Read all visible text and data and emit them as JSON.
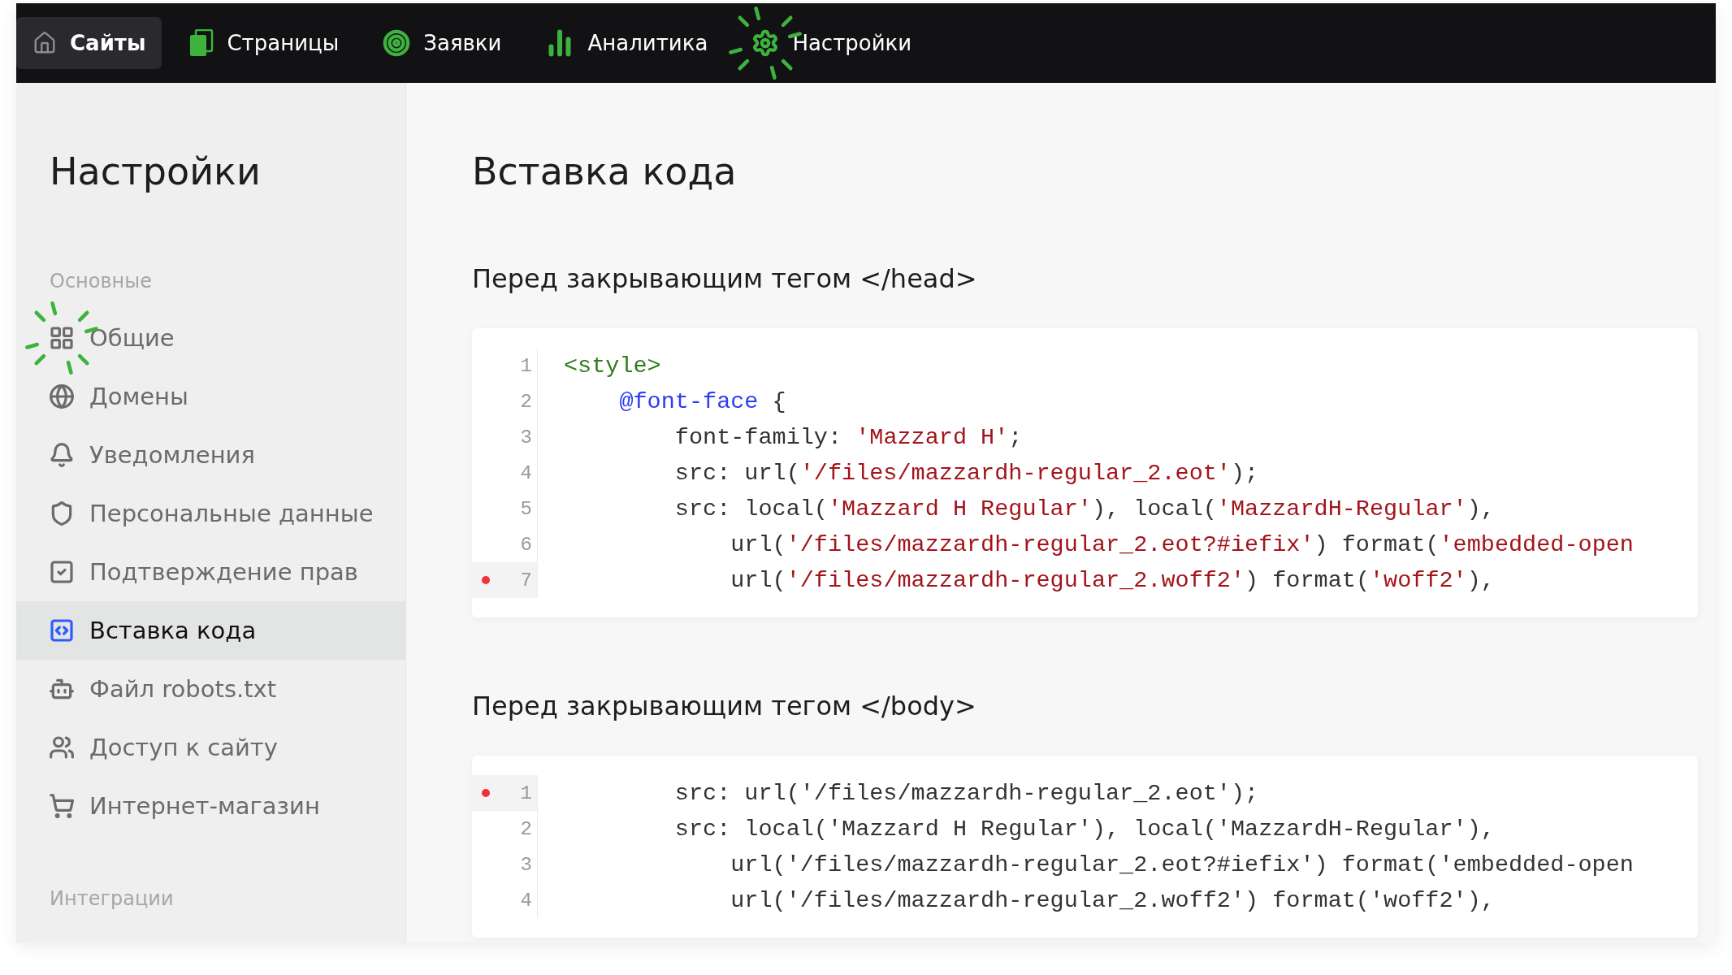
{
  "nav": {
    "items": [
      {
        "label": "Сайты",
        "selected": true,
        "hint": false
      },
      {
        "label": "Страницы",
        "selected": false,
        "hint": false
      },
      {
        "label": "Заявки",
        "selected": false,
        "hint": false
      },
      {
        "label": "Аналитика",
        "selected": false,
        "hint": false
      },
      {
        "label": "Настройки",
        "selected": false,
        "hint": true
      }
    ]
  },
  "sidebar": {
    "title": "Настройки",
    "groups": [
      {
        "label": "Основные",
        "items": [
          {
            "label": "Общие",
            "selected": false,
            "hint": true
          },
          {
            "label": "Домены",
            "selected": false,
            "hint": false
          },
          {
            "label": "Уведомления",
            "selected": false,
            "hint": false
          },
          {
            "label": "Персональные данные",
            "selected": false,
            "hint": false
          },
          {
            "label": "Подтверждение прав",
            "selected": false,
            "hint": false
          },
          {
            "label": "Вставка кода",
            "selected": true,
            "hint": false
          },
          {
            "label": "Файл robots.txt",
            "selected": false,
            "hint": false
          },
          {
            "label": "Доступ к сайту",
            "selected": false,
            "hint": false
          },
          {
            "label": "Интернет-магазин",
            "selected": false,
            "hint": false
          }
        ]
      },
      {
        "label": "Интеграции"
      }
    ]
  },
  "main": {
    "title": "Вставка кода",
    "sections": [
      {
        "heading": "Перед закрывающим тегом </head>",
        "lines": [
          {
            "number": "1",
            "breakpoint": false,
            "tokens": [
              {
                "kind": "tag",
                "text": "<style>"
              }
            ]
          },
          {
            "number": "2",
            "breakpoint": false,
            "tokens": [
              {
                "kind": "keyword",
                "text": "    @font-face"
              },
              {
                "kind": "plain",
                "text": " {"
              }
            ]
          },
          {
            "number": "3",
            "breakpoint": false,
            "tokens": [
              {
                "kind": "plain",
                "text": "        font-family: "
              },
              {
                "kind": "string",
                "text": "'Mazzard H'"
              },
              {
                "kind": "plain",
                "text": ";"
              }
            ]
          },
          {
            "number": "4",
            "breakpoint": false,
            "tokens": [
              {
                "kind": "plain",
                "text": "        src: url("
              },
              {
                "kind": "string",
                "text": "'/files/mazzardh-regular_2.eot'"
              },
              {
                "kind": "plain",
                "text": ");"
              }
            ]
          },
          {
            "number": "5",
            "breakpoint": false,
            "tokens": [
              {
                "kind": "plain",
                "text": "        src: local("
              },
              {
                "kind": "string",
                "text": "'Mazzard H Regular'"
              },
              {
                "kind": "plain",
                "text": "), local("
              },
              {
                "kind": "string",
                "text": "'MazzardH-Regular'"
              },
              {
                "kind": "plain",
                "text": "),"
              }
            ]
          },
          {
            "number": "6",
            "breakpoint": false,
            "tokens": [
              {
                "kind": "plain",
                "text": "            url("
              },
              {
                "kind": "string",
                "text": "'/files/mazzardh-regular_2.eot?#iefix'"
              },
              {
                "kind": "plain",
                "text": ") format("
              },
              {
                "kind": "string",
                "text": "'embedded-open"
              }
            ]
          },
          {
            "number": "7",
            "breakpoint": true,
            "tokens": [
              {
                "kind": "plain",
                "text": "            url("
              },
              {
                "kind": "string",
                "text": "'/files/mazzardh-regular_2.woff2'"
              },
              {
                "kind": "plain",
                "text": ") format("
              },
              {
                "kind": "string",
                "text": "'woff2'"
              },
              {
                "kind": "plain",
                "text": "),"
              }
            ]
          }
        ]
      },
      {
        "heading": "Перед закрывающим тегом </body>",
        "lines": [
          {
            "number": "1",
            "breakpoint": true,
            "tokens": [
              {
                "kind": "plain",
                "text": "        src: url('/files/mazzardh-regular_2.eot');"
              }
            ]
          },
          {
            "number": "2",
            "breakpoint": false,
            "tokens": [
              {
                "kind": "plain",
                "text": "        src: local('Mazzard H Regular'), local('MazzardH-Regular'),"
              }
            ]
          },
          {
            "number": "3",
            "breakpoint": false,
            "tokens": [
              {
                "kind": "plain",
                "text": "            url('/files/mazzardh-regular_2.eot?#iefix') format('embedded-open"
              }
            ]
          },
          {
            "number": "4",
            "breakpoint": false,
            "tokens": [
              {
                "kind": "plain",
                "text": "            url('/files/mazzardh-regular_2.woff2') format('woff2'),"
              }
            ]
          }
        ]
      }
    ]
  }
}
